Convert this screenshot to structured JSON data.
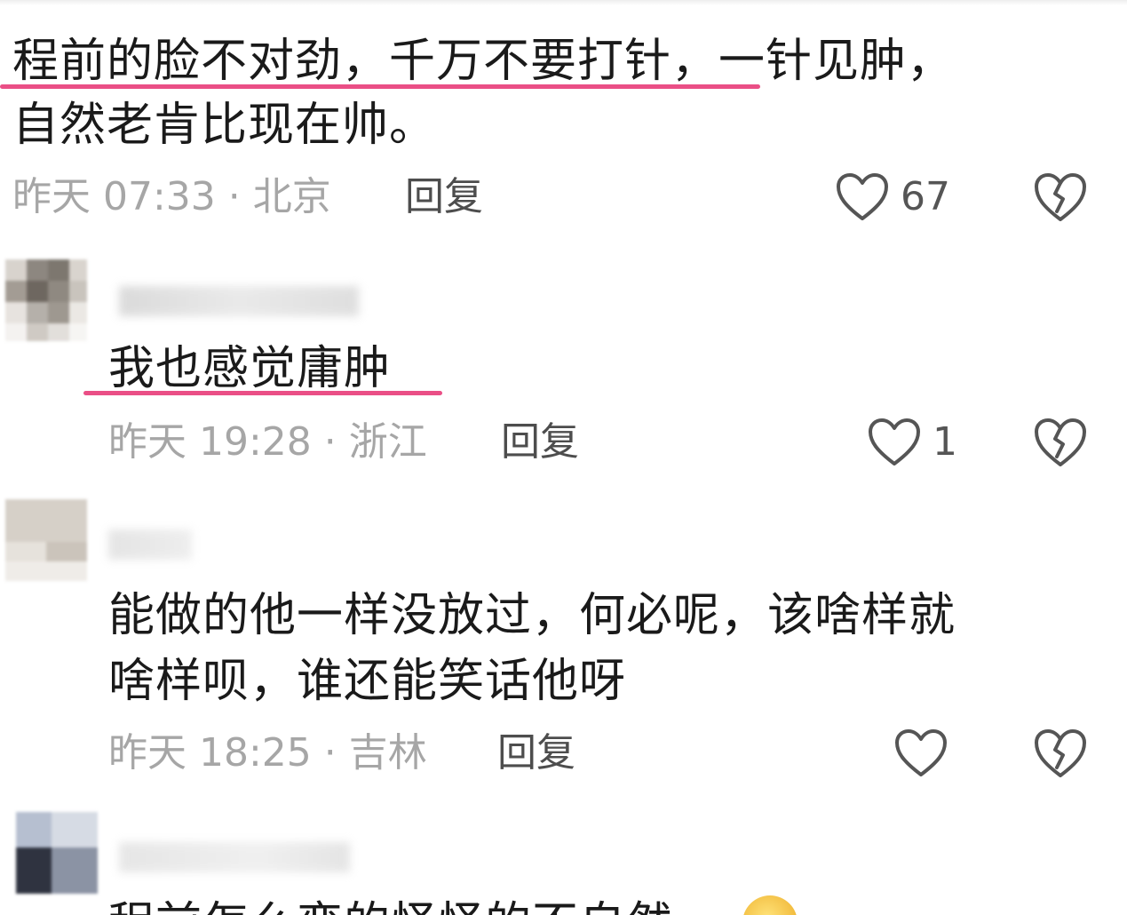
{
  "comments": [
    {
      "text_lines": [
        "程前的脸不对劲，千万不要打针，一针见肿，",
        "自然老肯比现在帅。"
      ],
      "meta": "昨天 07:33 · 北京",
      "reply_label": "回复",
      "like_count": "67"
    },
    {
      "text_lines": [
        "我也感觉庸肿"
      ],
      "meta": "昨天 19:28 · 浙江",
      "reply_label": "回复",
      "like_count": "1"
    },
    {
      "text_lines": [
        "能做的他一样没放过，何必呢，该啥样就",
        "啥样呗，谁还能笑话他呀"
      ],
      "meta": "昨天 18:25 · 吉林",
      "reply_label": "回复",
      "like_count": ""
    },
    {
      "text_lines": [
        "程前怎么变的怪怪的不自然"
      ]
    }
  ],
  "icons": {
    "like": "heart-outline-icon",
    "dislike": "broken-heart-icon",
    "emoji": "face-emoji-icon"
  },
  "colors": {
    "underline": "#ea4f86",
    "meta": "#a6a6a6",
    "text": "#1a1a1a"
  }
}
